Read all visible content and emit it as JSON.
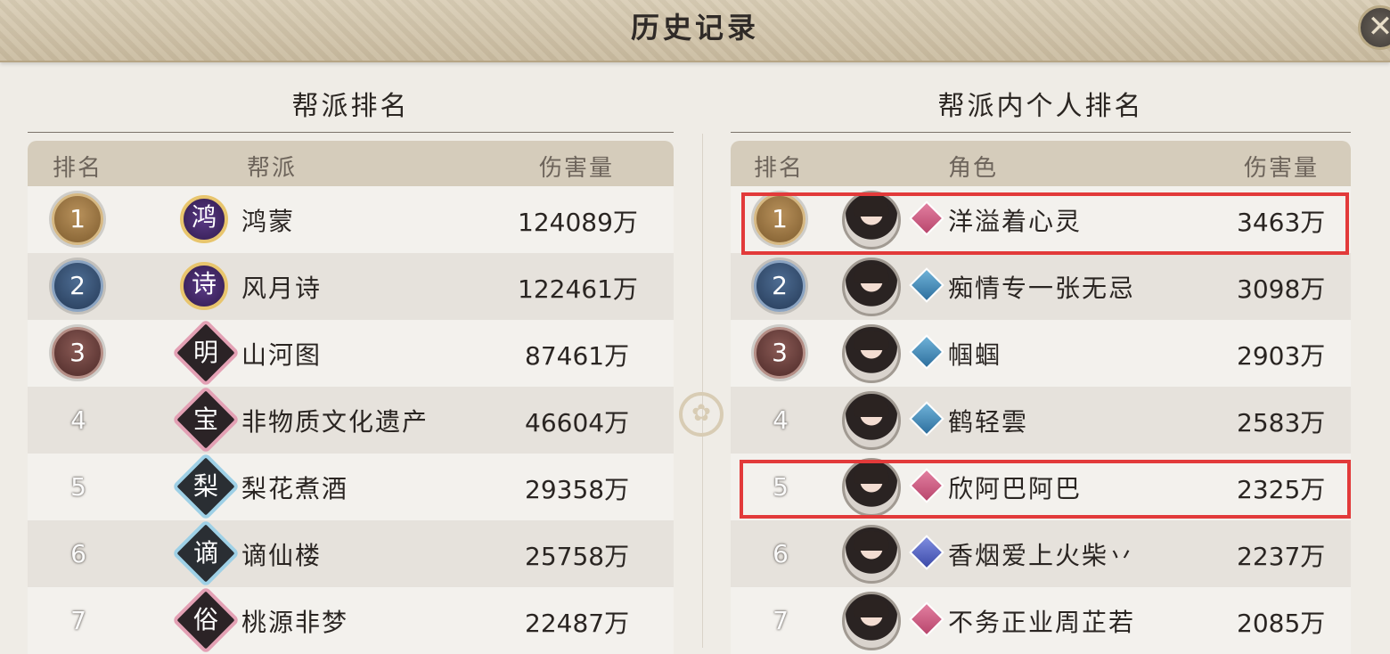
{
  "window": {
    "title": "历史记录",
    "close_label": "✕"
  },
  "left": {
    "title": "帮派排名",
    "headers": {
      "rank": "排名",
      "guild": "帮派",
      "damage": "伤害量"
    },
    "rows": [
      {
        "rank": "1",
        "emblem": "鸿",
        "name": "鸿蒙",
        "damage": "124089万"
      },
      {
        "rank": "2",
        "emblem": "诗",
        "name": "风月诗",
        "damage": "122461万"
      },
      {
        "rank": "3",
        "emblem": "明",
        "name": "山河图",
        "damage": "87461万"
      },
      {
        "rank": "4",
        "emblem": "宝",
        "name": "非物质文化遗产",
        "damage": "46604万"
      },
      {
        "rank": "5",
        "emblem": "梨",
        "name": "梨花煮酒",
        "damage": "29358万"
      },
      {
        "rank": "6",
        "emblem": "谪",
        "name": "谪仙楼",
        "damage": "25758万"
      },
      {
        "rank": "7",
        "emblem": "俗",
        "name": "桃源非梦",
        "damage": "22487万"
      }
    ]
  },
  "right": {
    "title": "帮派内个人排名",
    "headers": {
      "rank": "排名",
      "role": "角色",
      "damage": "伤害量"
    },
    "rows": [
      {
        "rank": "1",
        "name": "洋溢着心灵",
        "damage": "3463万",
        "class_icon": "pink-class-icon"
      },
      {
        "rank": "2",
        "name": "痴情专一张无忌",
        "damage": "3098万",
        "class_icon": "blue-class-icon"
      },
      {
        "rank": "3",
        "name": "帼蝈",
        "damage": "2903万",
        "class_icon": "blue-class-icon"
      },
      {
        "rank": "4",
        "name": "鹤轻雲",
        "damage": "2583万",
        "class_icon": "blue-class-icon"
      },
      {
        "rank": "5",
        "name": "欣阿巴阿巴",
        "damage": "2325万",
        "class_icon": "pink-class-icon"
      },
      {
        "rank": "6",
        "name": "香烟爱上火柴丷",
        "damage": "2237万",
        "class_icon": "indigo-class-icon"
      },
      {
        "rank": "7",
        "name": "不务正业周芷若",
        "damage": "2085万",
        "class_icon": "pink-class-icon"
      }
    ]
  },
  "colors": {
    "highlight": "#e23a3a",
    "header_bg": "#d5ccbb",
    "title_bg": "#d9cdb5"
  }
}
